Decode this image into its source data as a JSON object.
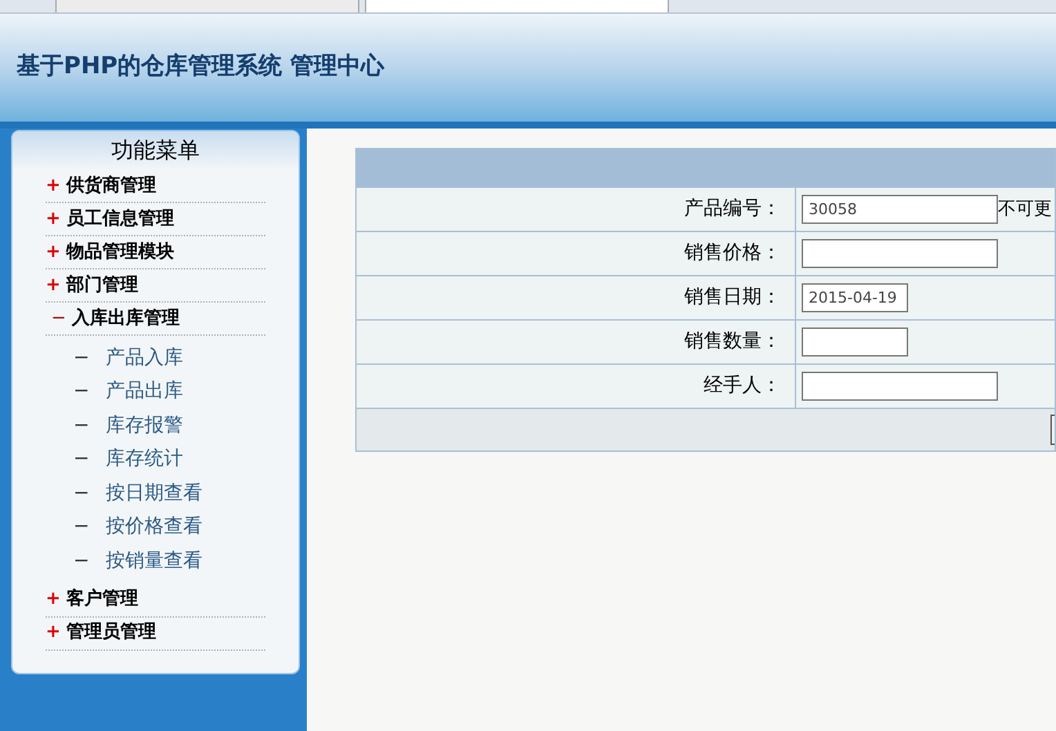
{
  "header": {
    "title": "基于PHP的仓库管理系统 管理中心"
  },
  "sidebar": {
    "title": "功能菜单",
    "groups": [
      {
        "marker": "+",
        "label": "供货商管理",
        "expanded": false
      },
      {
        "marker": "+",
        "label": "员工信息管理",
        "expanded": false
      },
      {
        "marker": "+",
        "label": "物品管理模块",
        "expanded": false
      },
      {
        "marker": "+",
        "label": "部门管理",
        "expanded": false
      },
      {
        "marker": "−",
        "label": "入库出库管理",
        "expanded": true,
        "children": [
          {
            "marker": "−",
            "label": "产品入库"
          },
          {
            "marker": "−",
            "label": "产品出库"
          },
          {
            "marker": "−",
            "label": "库存报警"
          },
          {
            "marker": "−",
            "label": "库存统计"
          },
          {
            "marker": "−",
            "label": "按日期查看"
          },
          {
            "marker": "−",
            "label": "按价格查看"
          },
          {
            "marker": "−",
            "label": "按销量查看"
          }
        ]
      },
      {
        "marker": "+",
        "label": "客户管理",
        "expanded": false
      },
      {
        "marker": "+",
        "label": "管理员管理",
        "expanded": false
      }
    ]
  },
  "form": {
    "rows": [
      {
        "label": "产品编号：",
        "value": "30058",
        "kind": "wide",
        "note": "不可更"
      },
      {
        "label": "销售价格：",
        "value": "",
        "kind": "wide"
      },
      {
        "label": "销售日期：",
        "value": "2015-04-19",
        "kind": "narrow"
      },
      {
        "label": "销售数量：",
        "value": "",
        "kind": "narrow"
      },
      {
        "label": "经手人：",
        "value": "",
        "kind": "wide"
      }
    ]
  }
}
